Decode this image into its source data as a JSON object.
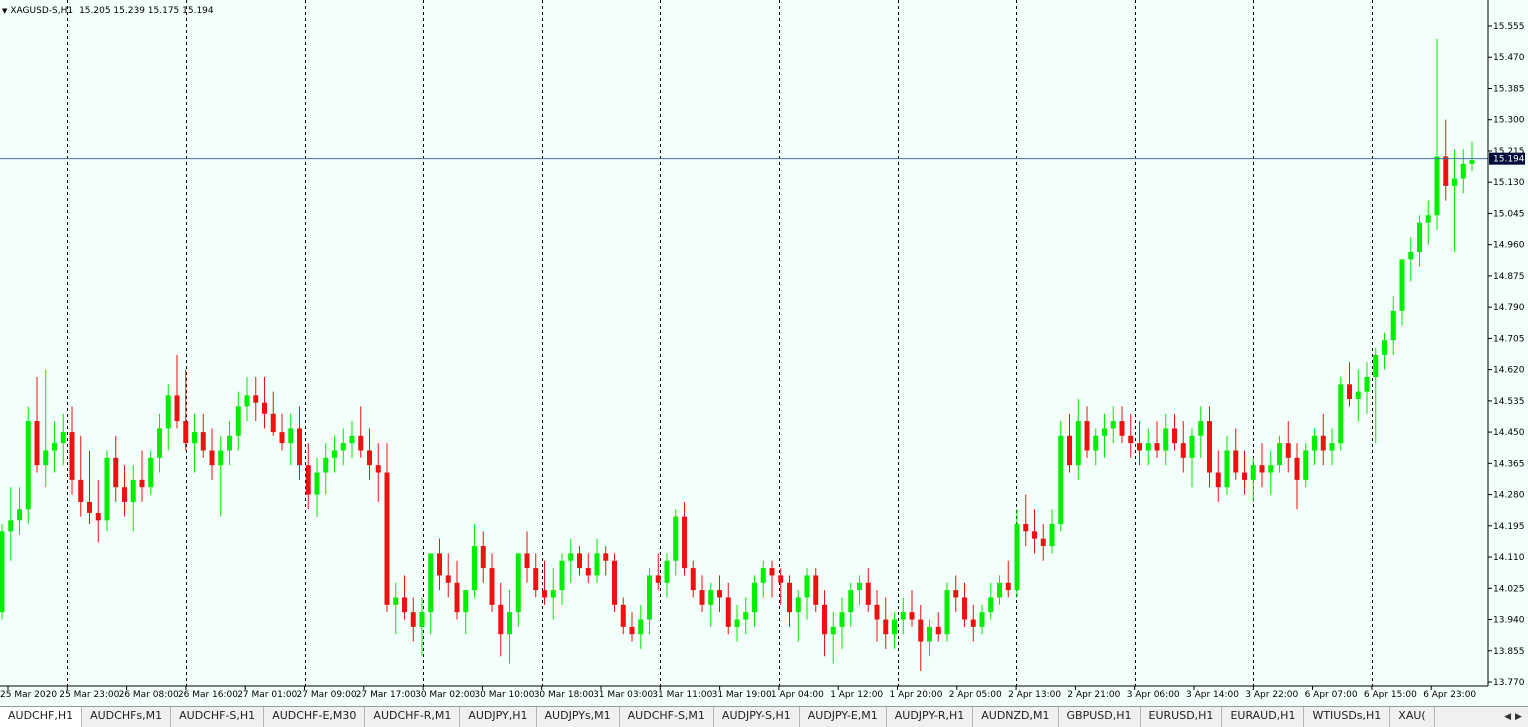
{
  "window": {
    "symbol_label": "XAGUSD-S,H1",
    "ohlc": "15.205 15.239 15.175 15.194",
    "current_price_label": "15.194"
  },
  "colors": {
    "background": "#f3fffa",
    "bull": "#00ee00",
    "bear": "#ee1111",
    "grid": "#000000",
    "price_line": "#4a6fa5",
    "price_tag_bg": "#000c3a"
  },
  "chart_data": {
    "type": "candlestick",
    "symbol": "XAGUSD-S",
    "timeframe": "H1",
    "ylim": [
      13.74,
      15.6
    ],
    "y_ticks": [
      "15.555",
      "15.470",
      "15.385",
      "15.300",
      "15.215",
      "15.130",
      "15.045",
      "14.960",
      "14.875",
      "14.790",
      "14.705",
      "14.620",
      "14.535",
      "14.450",
      "14.365",
      "14.280",
      "14.195",
      "14.110",
      "14.025",
      "13.940",
      "13.855",
      "13.770"
    ],
    "x_ticks": [
      "25 Mar 2020",
      "25 Mar 23:00",
      "26 Mar 08:00",
      "26 Mar 16:00",
      "27 Mar 01:00",
      "27 Mar 09:00",
      "27 Mar 17:00",
      "30 Mar 02:00",
      "30 Mar 10:00",
      "30 Mar 18:00",
      "31 Mar 03:00",
      "31 Mar 11:00",
      "31 Mar 19:00",
      "1 Apr 04:00",
      "1 Apr 12:00",
      "1 Apr 20:00",
      "2 Apr 05:00",
      "2 Apr 13:00",
      "2 Apr 21:00",
      "3 Apr 06:00",
      "3 Apr 14:00",
      "3 Apr 22:00",
      "6 Apr 07:00",
      "6 Apr 15:00",
      "6 Apr 23:00"
    ],
    "separator_after_tick": [
      1,
      3,
      5,
      7,
      9,
      11,
      13,
      15,
      17,
      19,
      21,
      23
    ],
    "current_price": 15.194,
    "grid": false,
    "candles_ohlc": [
      [
        13.96,
        14.2,
        13.94,
        14.18
      ],
      [
        14.18,
        14.3,
        14.1,
        14.21
      ],
      [
        14.21,
        14.3,
        14.17,
        14.24
      ],
      [
        14.24,
        14.52,
        14.2,
        14.48
      ],
      [
        14.48,
        14.6,
        14.34,
        14.36
      ],
      [
        14.36,
        14.62,
        14.3,
        14.4
      ],
      [
        14.4,
        14.48,
        14.34,
        14.42
      ],
      [
        14.42,
        14.5,
        14.36,
        14.45
      ],
      [
        14.45,
        14.52,
        14.28,
        14.32
      ],
      [
        14.32,
        14.44,
        14.22,
        14.26
      ],
      [
        14.26,
        14.4,
        14.2,
        14.23
      ],
      [
        14.23,
        14.32,
        14.15,
        14.21
      ],
      [
        14.21,
        14.4,
        14.18,
        14.38
      ],
      [
        14.38,
        14.44,
        14.26,
        14.3
      ],
      [
        14.3,
        14.36,
        14.22,
        14.26
      ],
      [
        14.26,
        14.36,
        14.18,
        14.32
      ],
      [
        14.32,
        14.4,
        14.26,
        14.3
      ],
      [
        14.3,
        14.4,
        14.28,
        14.38
      ],
      [
        14.38,
        14.5,
        14.34,
        14.46
      ],
      [
        14.46,
        14.58,
        14.4,
        14.55
      ],
      [
        14.55,
        14.66,
        14.46,
        14.48
      ],
      [
        14.48,
        14.62,
        14.4,
        14.42
      ],
      [
        14.42,
        14.5,
        14.34,
        14.45
      ],
      [
        14.45,
        14.5,
        14.38,
        14.4
      ],
      [
        14.4,
        14.46,
        14.32,
        14.36
      ],
      [
        14.36,
        14.44,
        14.22,
        14.4
      ],
      [
        14.4,
        14.48,
        14.36,
        14.44
      ],
      [
        14.44,
        14.56,
        14.4,
        14.52
      ],
      [
        14.52,
        14.6,
        14.48,
        14.55
      ],
      [
        14.55,
        14.6,
        14.48,
        14.53
      ],
      [
        14.53,
        14.6,
        14.46,
        14.5
      ],
      [
        14.5,
        14.56,
        14.44,
        14.45
      ],
      [
        14.45,
        14.5,
        14.4,
        14.42
      ],
      [
        14.42,
        14.5,
        14.36,
        14.46
      ],
      [
        14.46,
        14.52,
        14.32,
        14.36
      ],
      [
        14.36,
        14.42,
        14.24,
        14.28
      ],
      [
        14.28,
        14.38,
        14.22,
        14.34
      ],
      [
        14.34,
        14.42,
        14.28,
        14.38
      ],
      [
        14.38,
        14.44,
        14.34,
        14.4
      ],
      [
        14.4,
        14.46,
        14.36,
        14.42
      ],
      [
        14.42,
        14.48,
        14.38,
        14.44
      ],
      [
        14.44,
        14.52,
        14.38,
        14.4
      ],
      [
        14.4,
        14.46,
        14.32,
        14.36
      ],
      [
        14.36,
        14.42,
        14.26,
        14.34
      ],
      [
        14.34,
        14.42,
        13.96,
        13.98
      ],
      [
        13.98,
        14.04,
        13.9,
        14.0
      ],
      [
        14.0,
        14.06,
        13.94,
        13.96
      ],
      [
        13.96,
        14.0,
        13.88,
        13.92
      ],
      [
        13.92,
        14.0,
        13.84,
        13.96
      ],
      [
        13.96,
        14.06,
        13.9,
        14.12
      ],
      [
        14.12,
        14.16,
        14.02,
        14.06
      ],
      [
        14.06,
        14.12,
        14.0,
        14.04
      ],
      [
        14.04,
        14.1,
        13.94,
        13.96
      ],
      [
        13.96,
        14.02,
        13.9,
        14.02
      ],
      [
        14.02,
        14.2,
        14.0,
        14.14
      ],
      [
        14.14,
        14.18,
        14.04,
        14.08
      ],
      [
        14.08,
        14.12,
        13.96,
        13.98
      ],
      [
        13.98,
        14.04,
        13.84,
        13.9
      ],
      [
        13.9,
        14.02,
        13.82,
        13.96
      ],
      [
        13.96,
        14.08,
        13.92,
        14.12
      ],
      [
        14.12,
        14.18,
        14.04,
        14.08
      ],
      [
        14.08,
        14.12,
        14.0,
        14.02
      ],
      [
        14.02,
        14.1,
        13.98,
        14.0
      ],
      [
        14.0,
        14.08,
        13.94,
        14.02
      ],
      [
        14.02,
        14.12,
        13.98,
        14.1
      ],
      [
        14.1,
        14.16,
        14.04,
        14.12
      ],
      [
        14.12,
        14.14,
        14.06,
        14.08
      ],
      [
        14.08,
        14.12,
        14.04,
        14.06
      ],
      [
        14.06,
        14.16,
        14.04,
        14.12
      ],
      [
        14.12,
        14.14,
        14.06,
        14.1
      ],
      [
        14.1,
        14.12,
        13.96,
        13.98
      ],
      [
        13.98,
        14.0,
        13.9,
        13.92
      ],
      [
        13.92,
        13.96,
        13.88,
        13.9
      ],
      [
        13.9,
        13.98,
        13.86,
        13.94
      ],
      [
        13.94,
        14.08,
        13.9,
        14.06
      ],
      [
        14.06,
        14.12,
        14.02,
        14.04
      ],
      [
        14.04,
        14.12,
        14.0,
        14.1
      ],
      [
        14.1,
        14.24,
        14.06,
        14.22
      ],
      [
        14.22,
        14.26,
        14.06,
        14.08
      ],
      [
        14.08,
        14.1,
        14.0,
        14.02
      ],
      [
        14.02,
        14.06,
        13.96,
        13.98
      ],
      [
        13.98,
        14.04,
        13.92,
        14.02
      ],
      [
        14.02,
        14.06,
        13.96,
        14.0
      ],
      [
        14.0,
        14.04,
        13.9,
        13.92
      ],
      [
        13.92,
        13.98,
        13.88,
        13.94
      ],
      [
        13.94,
        14.0,
        13.9,
        13.96
      ],
      [
        13.96,
        14.06,
        13.92,
        14.04
      ],
      [
        14.04,
        14.1,
        14.0,
        14.08
      ],
      [
        14.08,
        14.1,
        14.0,
        14.06
      ],
      [
        14.06,
        14.08,
        13.98,
        14.04
      ],
      [
        14.04,
        14.06,
        13.92,
        13.96
      ],
      [
        13.96,
        14.02,
        13.88,
        14.0
      ],
      [
        14.0,
        14.08,
        13.94,
        14.06
      ],
      [
        14.06,
        14.08,
        13.96,
        13.98
      ],
      [
        13.98,
        14.02,
        13.84,
        13.9
      ],
      [
        13.9,
        13.96,
        13.82,
        13.92
      ],
      [
        13.92,
        14.0,
        13.86,
        13.96
      ],
      [
        13.96,
        14.04,
        13.92,
        14.02
      ],
      [
        14.02,
        14.06,
        13.98,
        14.04
      ],
      [
        14.04,
        14.08,
        13.96,
        13.98
      ],
      [
        13.98,
        14.02,
        13.88,
        13.94
      ],
      [
        13.94,
        14.0,
        13.86,
        13.9
      ],
      [
        13.9,
        13.96,
        13.86,
        13.94
      ],
      [
        13.94,
        14.0,
        13.9,
        13.96
      ],
      [
        13.96,
        14.02,
        13.92,
        13.94
      ],
      [
        13.94,
        13.98,
        13.8,
        13.88
      ],
      [
        13.88,
        13.94,
        13.84,
        13.92
      ],
      [
        13.92,
        13.96,
        13.88,
        13.9
      ],
      [
        13.9,
        14.04,
        13.88,
        14.02
      ],
      [
        14.02,
        14.06,
        13.96,
        14.0
      ],
      [
        14.0,
        14.04,
        13.92,
        13.94
      ],
      [
        13.94,
        13.98,
        13.88,
        13.92
      ],
      [
        13.92,
        13.98,
        13.9,
        13.96
      ],
      [
        13.96,
        14.04,
        13.94,
        14.0
      ],
      [
        14.0,
        14.06,
        13.98,
        14.04
      ],
      [
        14.04,
        14.1,
        14.0,
        14.02
      ],
      [
        14.02,
        14.24,
        14.0,
        14.2
      ],
      [
        14.2,
        14.28,
        14.14,
        14.18
      ],
      [
        14.18,
        14.24,
        14.12,
        14.16
      ],
      [
        14.16,
        14.2,
        14.1,
        14.14
      ],
      [
        14.14,
        14.24,
        14.12,
        14.2
      ],
      [
        14.2,
        14.48,
        14.18,
        14.44
      ],
      [
        14.44,
        14.5,
        14.34,
        14.36
      ],
      [
        14.36,
        14.54,
        14.32,
        14.48
      ],
      [
        14.48,
        14.52,
        14.38,
        14.4
      ],
      [
        14.4,
        14.46,
        14.36,
        14.44
      ],
      [
        14.44,
        14.5,
        14.38,
        14.46
      ],
      [
        14.46,
        14.52,
        14.42,
        14.48
      ],
      [
        14.48,
        14.52,
        14.42,
        14.44
      ],
      [
        14.44,
        14.5,
        14.38,
        14.42
      ],
      [
        14.42,
        14.48,
        14.36,
        14.4
      ],
      [
        14.4,
        14.46,
        14.36,
        14.42
      ],
      [
        14.42,
        14.48,
        14.38,
        14.4
      ],
      [
        14.4,
        14.5,
        14.36,
        14.46
      ],
      [
        14.46,
        14.5,
        14.4,
        14.42
      ],
      [
        14.42,
        14.48,
        14.34,
        14.38
      ],
      [
        14.38,
        14.46,
        14.3,
        14.44
      ],
      [
        14.44,
        14.52,
        14.38,
        14.48
      ],
      [
        14.48,
        14.52,
        14.3,
        14.34
      ],
      [
        14.34,
        14.4,
        14.26,
        14.3
      ],
      [
        14.3,
        14.44,
        14.28,
        14.4
      ],
      [
        14.4,
        14.46,
        14.32,
        14.34
      ],
      [
        14.34,
        14.4,
        14.28,
        14.32
      ],
      [
        14.32,
        14.38,
        14.26,
        14.36
      ],
      [
        14.36,
        14.42,
        14.3,
        14.34
      ],
      [
        14.34,
        14.4,
        14.28,
        14.36
      ],
      [
        14.36,
        14.44,
        14.34,
        14.42
      ],
      [
        14.42,
        14.48,
        14.34,
        14.38
      ],
      [
        14.38,
        14.42,
        14.24,
        14.32
      ],
      [
        14.32,
        14.42,
        14.3,
        14.4
      ],
      [
        14.4,
        14.46,
        14.36,
        14.44
      ],
      [
        14.44,
        14.5,
        14.36,
        14.4
      ],
      [
        14.4,
        14.46,
        14.36,
        14.42
      ],
      [
        14.42,
        14.6,
        14.4,
        14.58
      ],
      [
        14.58,
        14.64,
        14.52,
        14.54
      ],
      [
        14.54,
        14.62,
        14.48,
        14.56
      ],
      [
        14.56,
        14.64,
        14.5,
        14.6
      ],
      [
        14.6,
        14.68,
        14.42,
        14.66
      ],
      [
        14.66,
        14.72,
        14.62,
        14.7
      ],
      [
        14.7,
        14.82,
        14.66,
        14.78
      ],
      [
        14.78,
        14.88,
        14.74,
        14.92
      ],
      [
        14.92,
        14.98,
        14.86,
        14.94
      ],
      [
        14.94,
        15.04,
        14.9,
        15.02
      ],
      [
        15.02,
        15.08,
        14.96,
        15.04
      ],
      [
        15.04,
        15.52,
        15.0,
        15.2
      ],
      [
        15.2,
        15.3,
        15.08,
        15.12
      ],
      [
        15.12,
        15.22,
        14.94,
        15.14
      ],
      [
        15.14,
        15.22,
        15.1,
        15.18
      ],
      [
        15.18,
        15.24,
        15.16,
        15.19
      ]
    ]
  },
  "tabs": [
    "AUDCHF,H1",
    "AUDCHFs,M1",
    "AUDCHF-S,H1",
    "AUDCHF-E,M30",
    "AUDCHF-R,M1",
    "AUDJPY,H1",
    "AUDJPYs,M1",
    "AUDCHF-S,M1",
    "AUDJPY-S,H1",
    "AUDJPY-E,M1",
    "AUDJPY-R,H1",
    "AUDNZD,M1",
    "GBPUSD,H1",
    "EURUSD,H1",
    "EURAUD,H1",
    "WTIUSDs,H1",
    "XAU("
  ],
  "tab_nav": {
    "prev_icon": "◀",
    "next_icon": "▶"
  }
}
